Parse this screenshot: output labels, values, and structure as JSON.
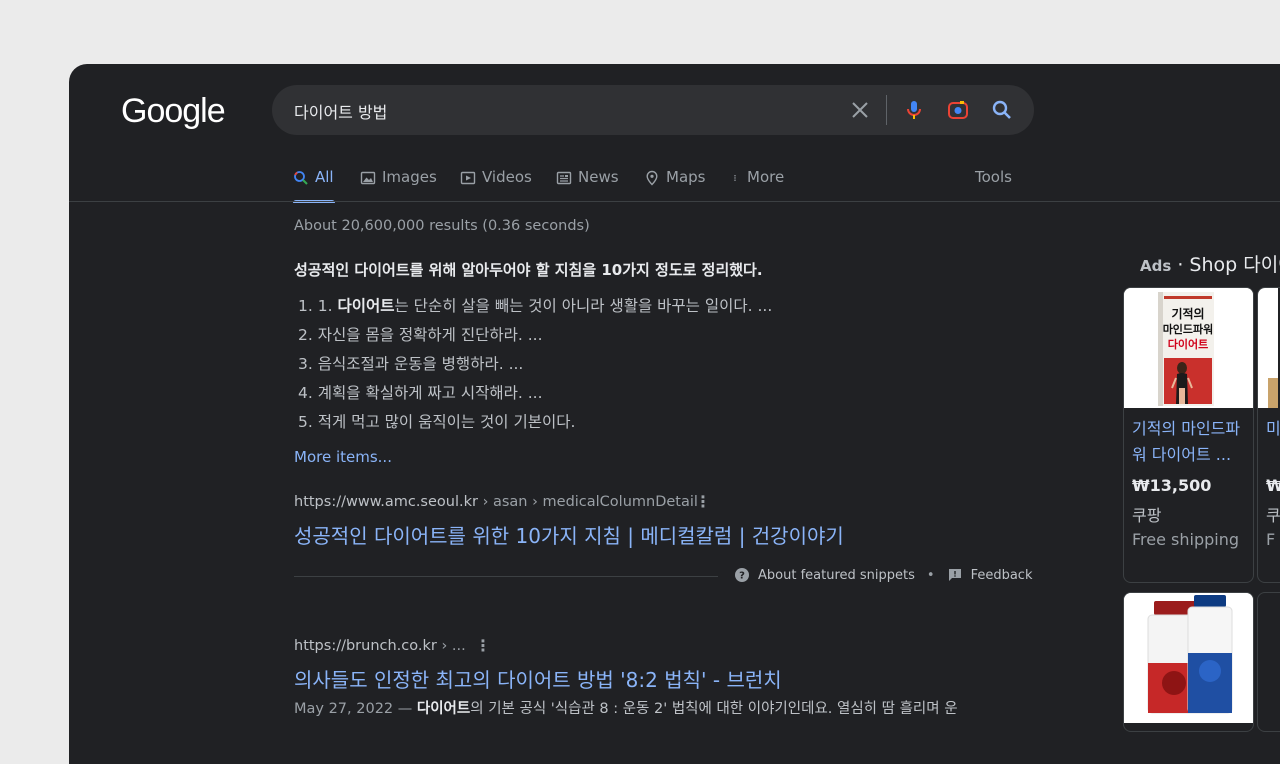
{
  "logo": "Google",
  "search": {
    "query": "다이어트 방법"
  },
  "tabs": [
    {
      "label": "All"
    },
    {
      "label": "Images"
    },
    {
      "label": "Videos"
    },
    {
      "label": "News"
    },
    {
      "label": "Maps"
    },
    {
      "label": "More"
    }
  ],
  "tools_label": "Tools",
  "stats": "About 20,600,000 results (0.36 seconds)",
  "featured_snippet": {
    "heading": "성공적인 다이어트를 위해 알아두어야 할 지침을 10가지 정도로 정리했다.",
    "items": [
      {
        "num": "1.",
        "prefix": "1. ",
        "bold": "다이어트",
        "rest": "는 단순히 살을 빼는 것이 아니라 생활을 바꾸는 일이다. ..."
      },
      {
        "num": "2.",
        "text": "자신을 몸을 정확하게 진단하라. ..."
      },
      {
        "num": "3.",
        "text": "음식조절과 운동을 병행하라. ..."
      },
      {
        "num": "4.",
        "text": "계획을 확실하게 짜고 시작해라. ..."
      },
      {
        "num": "5.",
        "text": "적게 먹고 많이 움직이는 것이 기본이다."
      }
    ],
    "more_items": "More items...",
    "url_host": "https://www.amc.seoul.kr",
    "url_path": " › asan › medicalColumnDetail",
    "title": "성공적인 다이어트를 위한 10가지 지침 | 메디컬칼럼 | 건강이야기",
    "about_label": "About featured snippets",
    "separator": "•",
    "feedback_label": "Feedback"
  },
  "result2": {
    "url_host": "https://brunch.co.kr",
    "url_path": " › ...",
    "title": "의사들도 인정한 최고의 다이어트 방법 '8:2 법칙' - 브런치",
    "date": "May 27, 2022 —",
    "bold": "다이어트",
    "rest": "의 기본 공식 '식습관 8 : 운동 2' 법칙에 대한 이야기인데요. 열심히 땀 흘리며 운"
  },
  "ads": {
    "label": "Ads",
    "sep": "·",
    "title": "Shop 다이어",
    "cards": [
      {
        "title": "기적의 마인드파워 다이어트 ...",
        "price": "₩13,500",
        "seller": "쿠팡",
        "shipping": "Free shipping",
        "book_title_1": "기적의",
        "book_title_2": "마인드파워",
        "book_title_3": "다이어트"
      },
      {
        "title": "미어",
        "price": "₩",
        "seller": "쿠",
        "shipping": "F"
      }
    ]
  },
  "colors": {
    "background": "#202124",
    "link": "#8ab4f8",
    "text": "#bdc1c6",
    "muted": "#9aa0a6"
  }
}
